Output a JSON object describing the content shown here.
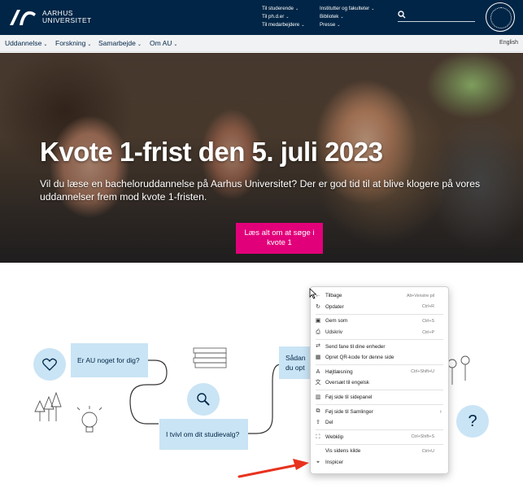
{
  "header": {
    "logo_line1": "AARHUS",
    "logo_line2": "UNIVERSITET",
    "links_col1": [
      {
        "label": "Til studerende"
      },
      {
        "label": "Til ph.d.er"
      },
      {
        "label": "Til medarbejdere"
      }
    ],
    "links_col2": [
      {
        "label": "Institutter og fakulteter"
      },
      {
        "label": "Bibliotek"
      },
      {
        "label": "Presse"
      }
    ],
    "chevron": "⌄"
  },
  "nav": {
    "items": [
      {
        "label": "Uddannelse"
      },
      {
        "label": "Forskning"
      },
      {
        "label": "Samarbejde"
      },
      {
        "label": "Om AU"
      }
    ],
    "language": "English"
  },
  "hero": {
    "title": "Kvote 1-frist den 5. juli 2023",
    "text": "Vil du læse en bacheloruddannelse på Aarhus Universitet? Der er god tid til at blive klogere på vores uddannelser frem mod kvote 1-fristen.",
    "cta": "Læs alt om at søge i kvote 1"
  },
  "flow": {
    "q1": "Er AU noget for dig?",
    "q2": "I tvivl om dit studievalg?",
    "q3_partial_line1": "Sådan",
    "q3_partial_line2": "du opt",
    "question_mark": "?"
  },
  "context_menu": {
    "items": [
      {
        "icon": "back-icon",
        "glyph": "←",
        "label": "Tilbage",
        "shortcut": "Alt+Venstre pil"
      },
      {
        "icon": "refresh-icon",
        "glyph": "↻",
        "label": "Opdater",
        "shortcut": "Ctrl+R"
      },
      {
        "icon": "save-icon",
        "glyph": "▣",
        "label": "Gem som",
        "shortcut": "Ctrl+S"
      },
      {
        "icon": "print-icon",
        "glyph": "⎙",
        "label": "Udskriv",
        "shortcut": "Ctrl+P"
      },
      {
        "icon": "send-tab-icon",
        "glyph": "⇄",
        "label": "Send fane til dine enheder",
        "shortcut": ""
      },
      {
        "icon": "qr-code-icon",
        "glyph": "▦",
        "label": "Opret QR-kode for denne side",
        "shortcut": ""
      },
      {
        "icon": "read-aloud-icon",
        "glyph": "A",
        "label": "Højtlæsning",
        "shortcut": "Ctrl+Shift+U"
      },
      {
        "icon": "translate-icon",
        "glyph": "文",
        "label": "Oversæt til engelsk",
        "shortcut": ""
      },
      {
        "icon": "side-panel-icon",
        "glyph": "▥",
        "label": "Føj side til sidepanel",
        "shortcut": ""
      },
      {
        "icon": "collections-icon",
        "glyph": "⧉",
        "label": "Føj side til Samlinger",
        "shortcut": ""
      },
      {
        "icon": "share-icon",
        "glyph": "⇪",
        "label": "Del",
        "shortcut": ""
      },
      {
        "icon": "web-capture-icon",
        "glyph": "⛶",
        "label": "Webklip",
        "shortcut": "Ctrl+Shift+S"
      },
      {
        "icon": "",
        "glyph": "",
        "label": "Vis sidens kilde",
        "shortcut": "Ctrl+U"
      },
      {
        "icon": "inspect-icon",
        "glyph": "⌖",
        "label": "Inspicer",
        "shortcut": ""
      }
    ],
    "submenu_arrow": "›"
  },
  "colors": {
    "brand_navy": "#002546",
    "cta_magenta": "#e2007a",
    "illustration_blue": "#c9e4f5",
    "annotation_red": "#e8321e"
  }
}
